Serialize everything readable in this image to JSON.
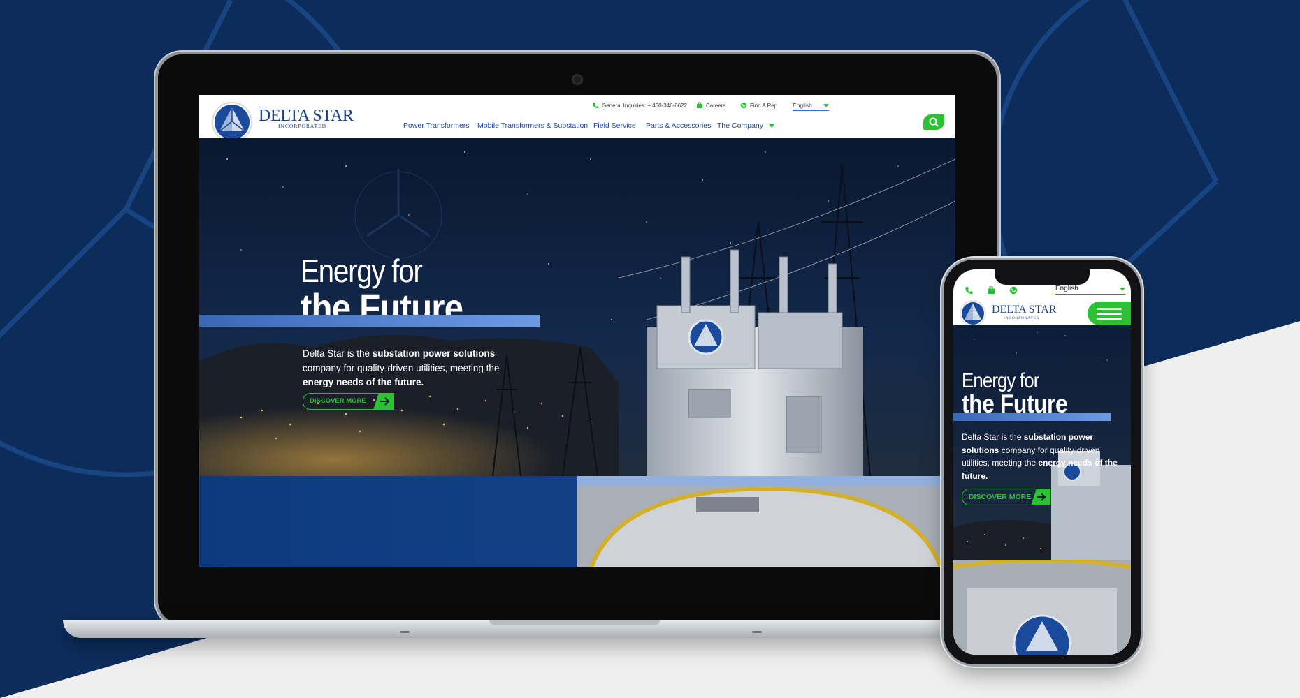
{
  "brand": {
    "name": "DELTA STAR",
    "subtitle": "INCORPORATED",
    "emblem_text": "DELTA STAR INC.",
    "colors": {
      "navy": "#0c2d5c",
      "blue": "#18418d",
      "green": "#2cc134",
      "accent_bar": "#5b8ede"
    }
  },
  "desktop": {
    "utility": {
      "phone": "General Inquiries: + 450-346-6622",
      "careers": "Careers",
      "find_rep": "Find A Rep",
      "language": "English"
    },
    "nav": [
      {
        "label": "Power Transformers"
      },
      {
        "label": "Mobile Transformers &  Substation"
      },
      {
        "label": "Field Service"
      },
      {
        "label": "Parts & Accessories"
      },
      {
        "label": "The Company"
      }
    ],
    "hero": {
      "line1": "Energy for",
      "line2": "the Future",
      "text_parts": [
        "Delta Star is the ",
        "substation power solutions",
        " company for quality-driven utilities, meeting the ",
        "energy needs of the future."
      ],
      "cta": "DISCOVER MORE"
    }
  },
  "mobile": {
    "language": "English",
    "hero": {
      "line1": "Energy for",
      "line2": "the Future",
      "text_parts": [
        "Delta Star is the ",
        "substation power solutions",
        " company for quality-driven utilities, meeting the ",
        "energy needs of the future."
      ],
      "cta": "DISCOVER MORE"
    }
  },
  "icons": [
    "phone-icon",
    "briefcase-icon",
    "globe-icon",
    "search-icon",
    "hamburger-menu-icon",
    "arrow-right-icon",
    "dropdown-caret-icon"
  ]
}
